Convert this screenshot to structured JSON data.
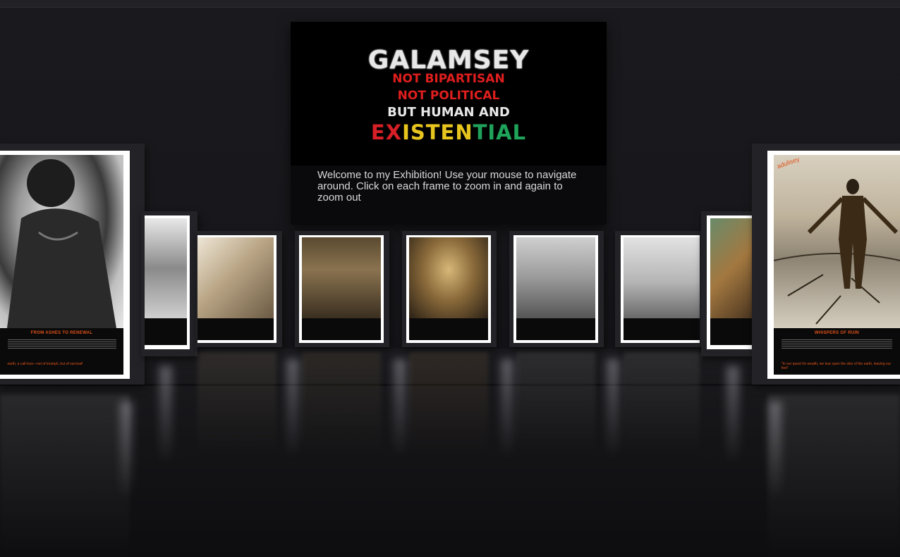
{
  "banner": {
    "title": "GALAMSEY",
    "line2": "NOT BIPARTISAN",
    "line3": "NOT POLITICAL",
    "line4": "BUT HUMAN AND",
    "line5_parts": [
      {
        "text": "EX",
        "color": "#d61f26"
      },
      {
        "text": "ISTEN",
        "color": "#e8c51e"
      },
      {
        "text": "TIAL",
        "color": "#1fa35a"
      }
    ],
    "welcome_text": "Welcome to my Exhibition! Use your mouse to navigate around. Click on each frame to zoom in and again to zoom out"
  },
  "frames": {
    "left_large": {
      "caption_title": "FROM ASHES TO RENEWAL",
      "caption_footer": "earth, a call-loss—not of triumph, but of survival!"
    },
    "right_large": {
      "caption_title": "WHISPERS OF RUIN",
      "caption_footer": "\"In our quest for wealth, we tear open the skin of the earth, leaving our\nfeet\"",
      "watermark": "adulisey"
    }
  }
}
